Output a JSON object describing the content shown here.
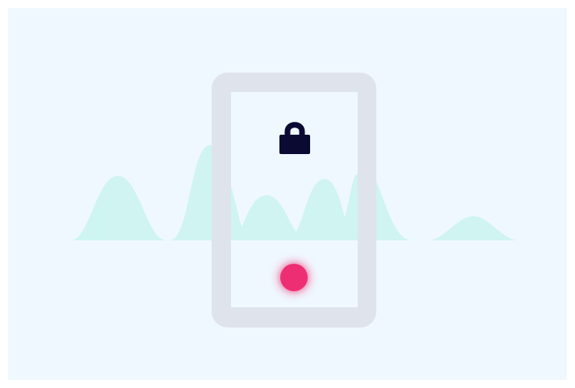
{
  "illustration": {
    "subject": "phone-lock-illustration",
    "icons": {
      "lock": "lock-icon",
      "record": "record-dot-icon"
    }
  },
  "colors": {
    "background": "#eff8fe",
    "phone_frame": "#dfe3ec",
    "phone_screen": "#eff8fe",
    "wave_fill": "#b5f2ea",
    "lock": "#0b0a33",
    "record_dot": "#ee2d72"
  }
}
